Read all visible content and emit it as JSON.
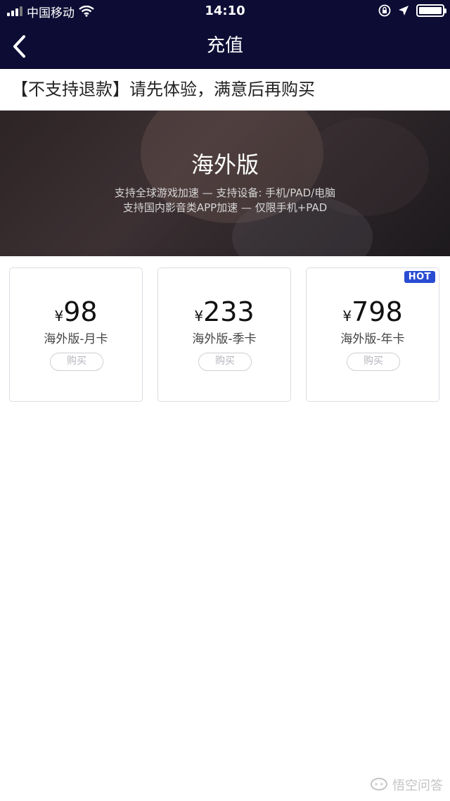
{
  "status_bar": {
    "carrier": "中国移动",
    "time": "14:10"
  },
  "header": {
    "title": "充值"
  },
  "notice": "【不支持退款】请先体验，满意后再购买",
  "banner": {
    "title": "海外版",
    "line1": "支持全球游戏加速 — 支持设备: 手机/PAD/电脑",
    "line2": "支持国内影音类APP加速 — 仅限手机+PAD"
  },
  "plans": [
    {
      "currency": "¥",
      "price": "98",
      "name": "海外版-月卡",
      "buy": "购买"
    },
    {
      "currency": "¥",
      "price": "233",
      "name": "海外版-季卡",
      "buy": "购买"
    },
    {
      "currency": "¥",
      "price": "798",
      "name": "海外版-年卡",
      "buy": "购买",
      "badge": "HOT"
    }
  ],
  "watermark": "悟空问答",
  "colors": {
    "header_bg": "#0c0c34",
    "hot_badge": "#2a4cd2"
  }
}
